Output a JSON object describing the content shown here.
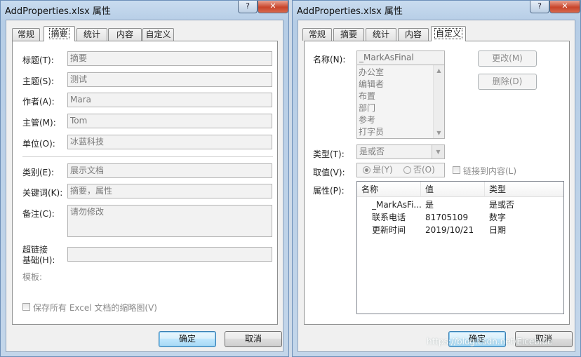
{
  "left_dialog": {
    "title": "AddProperties.xlsx 属性",
    "help_glyph": "?",
    "close_glyph": "✕",
    "tabs": [
      "常规",
      "摘要",
      "统计",
      "内容",
      "自定义"
    ],
    "active_tab": "摘要",
    "fields": [
      {
        "label": "标题(T):",
        "value": "摘要"
      },
      {
        "label": "主题(S):",
        "value": "测试"
      },
      {
        "label": "作者(A):",
        "value": "Mara"
      },
      {
        "label": "主管(M):",
        "value": "Tom"
      },
      {
        "label": "单位(O):",
        "value": "冰蓝科技"
      },
      {
        "label": "类别(E):",
        "value": "展示文档"
      },
      {
        "label": "关键词(K):",
        "value": "摘要，属性"
      },
      {
        "label": "备注(C):",
        "value": "请勿修改"
      }
    ],
    "hyperlink_label_1": "超链接",
    "hyperlink_label_2": "基础(H):",
    "hyperlink_value": "",
    "template_label": "模板:",
    "thumbnail_checkbox": "保存所有 Excel 文档的缩略图(V)",
    "ok": "确定",
    "cancel": "取消"
  },
  "right_dialog": {
    "title": "AddProperties.xlsx 属性",
    "help_glyph": "?",
    "close_glyph": "✕",
    "tabs": [
      "常规",
      "摘要",
      "统计",
      "内容",
      "自定义"
    ],
    "active_tab": "自定义",
    "name_label": "名称(N):",
    "name_value": "_MarkAsFinal",
    "name_list": [
      "办公室",
      "编辑者",
      "布置",
      "部门",
      "参考",
      "打字员"
    ],
    "modify_button": "更改(M)",
    "delete_button": "删除(D)",
    "type_label": "类型(T):",
    "type_value": "是或否",
    "value_label": "取值(V):",
    "yes_label": "是(Y)",
    "no_label": "否(O)",
    "link_checkbox": "链接到内容(L)",
    "properties_label": "属性(P):",
    "columns": [
      "名称",
      "值",
      "类型"
    ],
    "rows": [
      {
        "name": "_MarkAsFi...",
        "value": "是",
        "type": "是或否"
      },
      {
        "name": "联系电话",
        "value": "81705109",
        "type": "数字"
      },
      {
        "name": "更新时间",
        "value": "2019/10/21",
        "type": "日期"
      }
    ],
    "ok": "确定",
    "cancel": "取消"
  },
  "watermark": "https://blog.csdn.net/Eiceblue",
  "colors": {
    "accent_border": "#3c7fb1",
    "close_red": "#c8442b",
    "frame": "#b6cde6"
  }
}
